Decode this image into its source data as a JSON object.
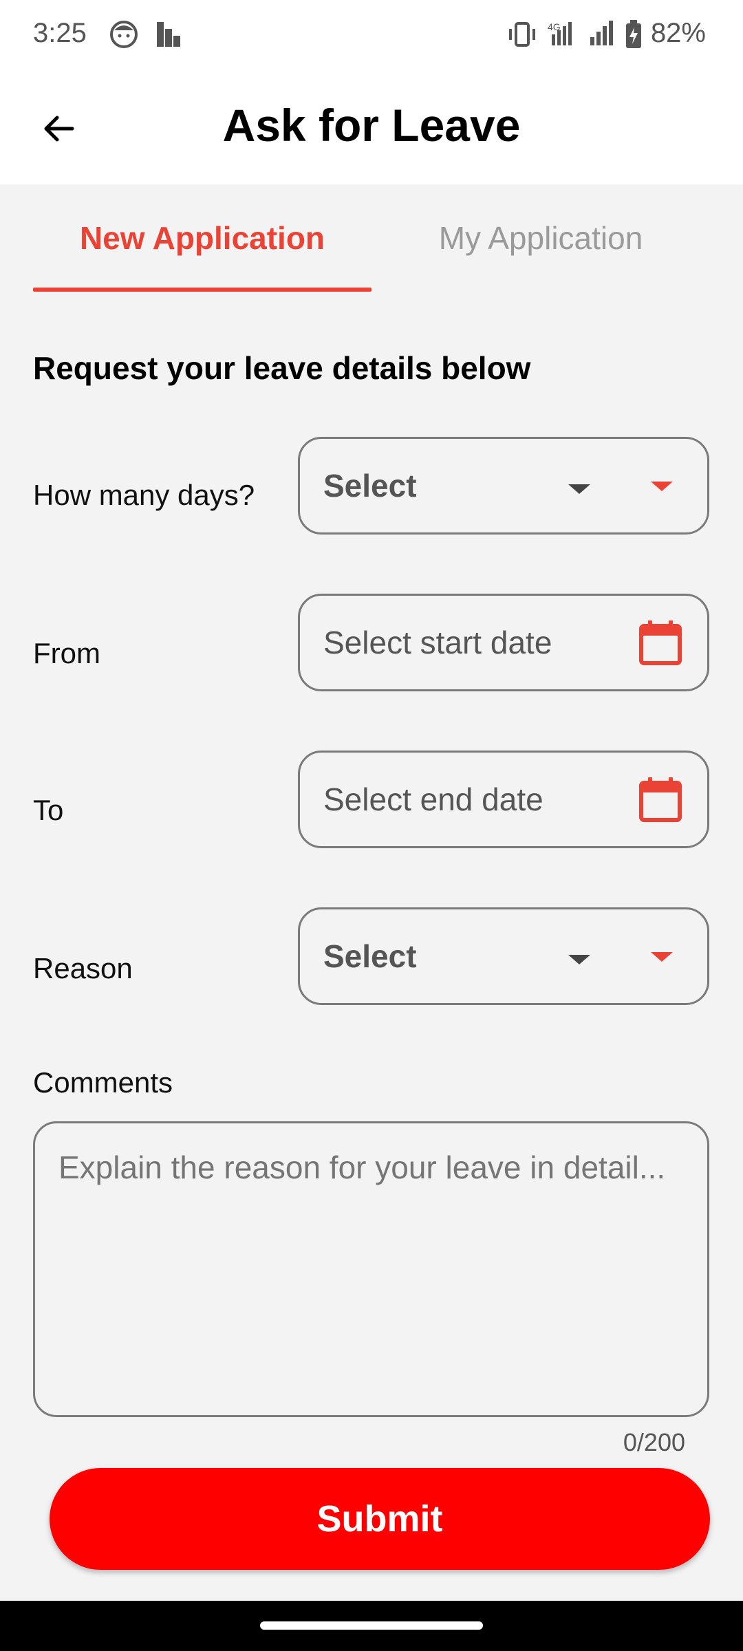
{
  "status_bar": {
    "time": "3:25",
    "network": "4G",
    "battery": "82%"
  },
  "app_bar": {
    "title": "Ask for Leave",
    "back_icon": "arrow-left-icon"
  },
  "tabs": [
    {
      "label": "New Application",
      "active": true
    },
    {
      "label": "My Application",
      "active": false
    }
  ],
  "form": {
    "heading": "Request your leave details below",
    "days": {
      "label": "How many days?",
      "value": "Select"
    },
    "from": {
      "label": "From",
      "placeholder": "Select start date",
      "icon": "calendar-icon"
    },
    "to": {
      "label": "To",
      "placeholder": "Select end date",
      "icon": "calendar-icon"
    },
    "reason": {
      "label": "Reason",
      "value": "Select"
    },
    "comments": {
      "label": "Comments",
      "placeholder": "Explain the reason for your leave in detail...",
      "counter": "0/200"
    },
    "submit_label": "Submit"
  },
  "colors": {
    "accent": "#ea4335",
    "submit": "#ff0000",
    "inactive_tab": "#9a9a9a"
  }
}
